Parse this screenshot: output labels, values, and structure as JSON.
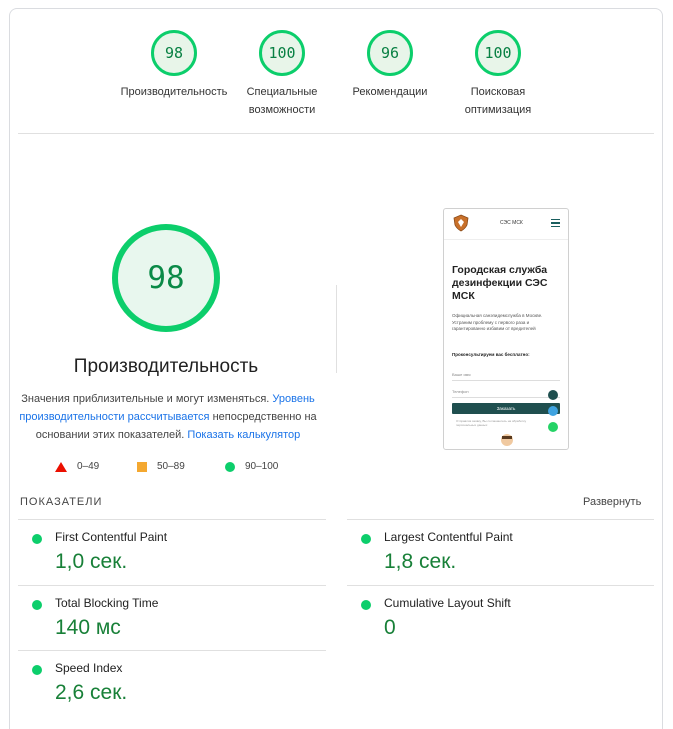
{
  "categories": [
    {
      "score": "98",
      "label": "Производительность"
    },
    {
      "score": "100",
      "label": "Специальные возможности"
    },
    {
      "score": "96",
      "label": "Рекомендации"
    },
    {
      "score": "100",
      "label": "Поисковая оптимизация"
    }
  ],
  "performance": {
    "score": "98",
    "title": "Производительность",
    "desc_1": "Значения приблизительные и могут изменяться.",
    "desc_link_1": "Уровень производительности рассчитывается",
    "desc_2": "непосредственно на основании этих показателей.",
    "desc_link_2": "Показать калькулятор"
  },
  "legend": {
    "fail": "0–49",
    "average": "50–89",
    "pass": "90–100"
  },
  "colors": {
    "pass": "#0cce6b",
    "average": "#f4a830",
    "fail": "#eb0f00",
    "value_green": "#188038",
    "link": "#1a73e8"
  },
  "screenshot": {
    "brand": "СЭС МСК",
    "headline": "Городская служба дезинфекции СЭС МСК",
    "paragraph": "Официальная санэпидемслужба в Москве. Устраним проблему с первого раза и гарантированно избавим от вредителей",
    "form_title": "Проконсультируем вас бесплатно:",
    "name_placeholder": "Ваше имя",
    "phone_placeholder": "Телефон",
    "button": "Заказать",
    "note": "Отправляя заявку, Вы соглашаетесь на обработку персональных данных"
  },
  "metrics_section": {
    "label": "ПОКАЗАТЕЛИ",
    "expand": "Развернуть"
  },
  "metrics": [
    {
      "name": "First Contentful Paint",
      "value": "1,0 сек."
    },
    {
      "name": "Largest Contentful Paint",
      "value": "1,8 сек."
    },
    {
      "name": "Total Blocking Time",
      "value": "140 мс"
    },
    {
      "name": "Cumulative Layout Shift",
      "value": "0"
    },
    {
      "name": "Speed Index",
      "value": "2,6 сек."
    }
  ]
}
